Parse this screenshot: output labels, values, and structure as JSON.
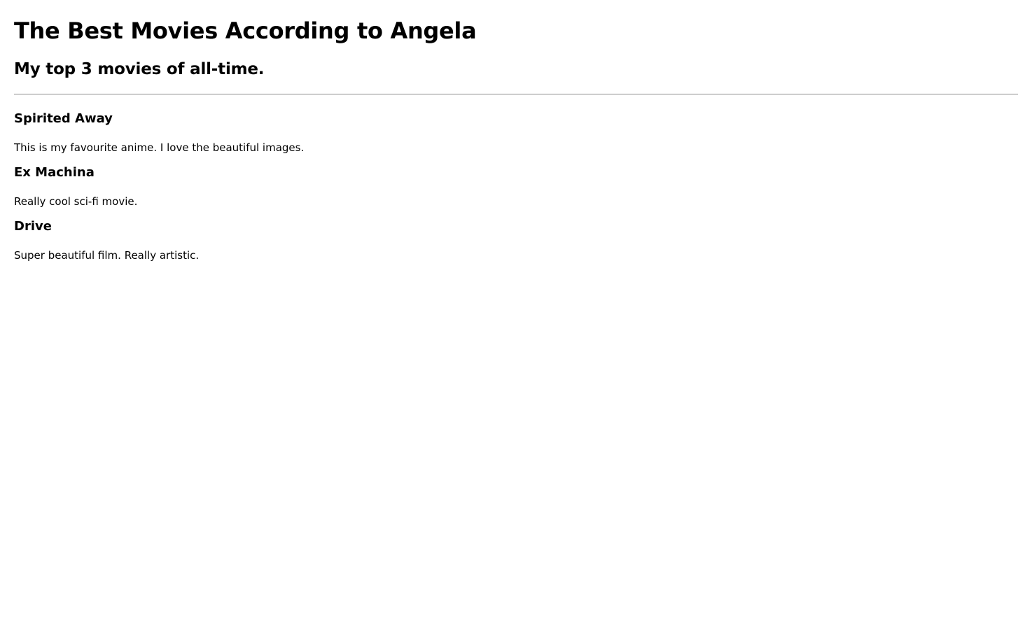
{
  "page": {
    "title": "The Best Movies According to Angela",
    "subtitle": "My top 3 movies of all-time."
  },
  "movies": [
    {
      "title": "Spirited Away",
      "description": "This is my favourite anime. I love the beautiful images."
    },
    {
      "title": "Ex Machina",
      "description": "Really cool sci-fi movie."
    },
    {
      "title": "Drive",
      "description": "Super beautiful film. Really artistic."
    }
  ],
  "colors": {
    "background": "#ffffff",
    "text": "#000000",
    "divider": "#8a8a8a"
  }
}
